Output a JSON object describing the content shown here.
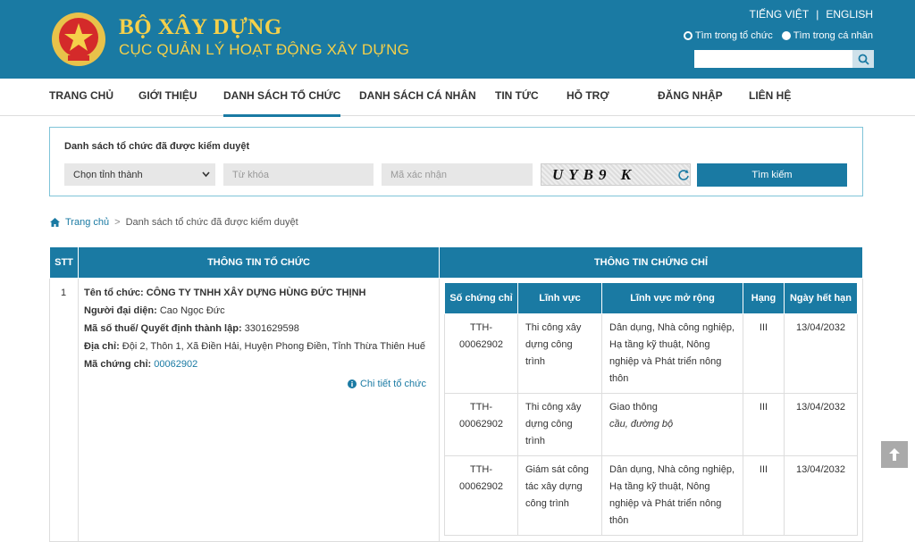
{
  "header": {
    "brand_line1": "BỘ XÂY DỰNG",
    "brand_line2": "CỤC QUẢN LÝ HOẠT ĐỘNG XÂY DỰNG",
    "lang_vi": "TIẾNG VIỆT",
    "lang_sep": "|",
    "lang_en": "ENGLISH",
    "radio_org": "Tìm trong tổ chức",
    "radio_person": "Tìm trong cá nhân",
    "search_value": ""
  },
  "nav": {
    "items": [
      "TRANG CHỦ",
      "GIỚI THIỆU",
      "DANH SÁCH TỔ CHỨC",
      "DANH SÁCH CÁ NHÂN",
      "TIN TỨC",
      "HỖ TRỢ",
      "ĐĂNG NHẬP",
      "LIÊN HỆ"
    ]
  },
  "search": {
    "title": "Danh sách tổ chức đã được kiểm duyệt",
    "province": "Chọn tỉnh thành",
    "keyword_placeholder": "Từ khóa",
    "captcha_placeholder": "Mã xác nhận",
    "captcha_text": "UYB9 K",
    "button": "Tìm kiếm"
  },
  "breadcrumb": {
    "home": "Trang chủ",
    "sep": ">",
    "current": "Danh sách tổ chức đã được kiểm duyệt"
  },
  "table": {
    "col_stt": "STT",
    "col_org": "THÔNG TIN TỔ CHỨC",
    "col_cert": "THÔNG TIN CHỨNG CHỈ",
    "row": {
      "stt": "1",
      "name_label": "Tên tổ chức:",
      "name": "CÔNG TY TNHH XÂY DỰNG HÙNG ĐỨC THỊNH",
      "rep_label": "Người đại diện:",
      "rep": "Cao Ngọc Đức",
      "tax_label": "Mã số thuế/ Quyết định thành lập:",
      "tax": "3301629598",
      "addr_label": "Địa chỉ:",
      "addr": "Đội 2, Thôn 1, Xã Điền Hải, Huyện Phong Điền, Tỉnh Thừa Thiên Huế",
      "cert_label": "Mã chứng chỉ:",
      "cert_code": "00062902",
      "detail_link": "Chi tiết tổ chức"
    },
    "cert_headers": [
      "Số chứng chỉ",
      "Lĩnh vực",
      "Lĩnh vực mở rộng",
      "Hạng",
      "Ngày hết hạn"
    ],
    "certs": [
      {
        "no_a": "TTH-",
        "no_b": "00062902",
        "field": "Thi công xây dựng công trình",
        "ext": "Dân dụng, Nhà công nghiệp, Hạ tầng kỹ thuật, Nông nghiệp và Phát triển nông thôn",
        "ext_note": "",
        "grade": "III",
        "expiry": "13/04/2032"
      },
      {
        "no_a": "TTH-",
        "no_b": "00062902",
        "field": "Thi công xây dựng công trình",
        "ext": "Giao thông",
        "ext_note": "cầu, đường bộ",
        "grade": "III",
        "expiry": "13/04/2032"
      },
      {
        "no_a": "TTH-",
        "no_b": "00062902",
        "field": "Giám sát công tác xây dựng công trình",
        "ext": "Dân dụng, Nhà công nghiệp, Hạ tầng kỹ thuật, Nông nghiệp và Phát triển nông thôn",
        "ext_note": "",
        "grade": "III",
        "expiry": "13/04/2032"
      }
    ]
  },
  "colors": {
    "primary": "#1a7aa3",
    "brand_gold": "#f5d04a"
  }
}
